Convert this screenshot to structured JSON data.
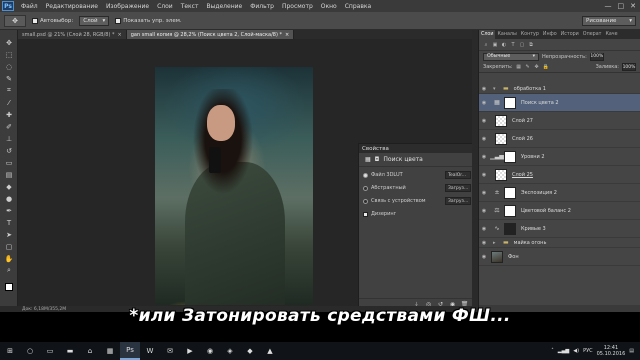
{
  "menubar": {
    "logo": "Ps",
    "items": [
      "Файл",
      "Редактирование",
      "Изображение",
      "Слои",
      "Текст",
      "Выделение",
      "Фильтр",
      "Просмотр",
      "Окно",
      "Справка"
    ],
    "win_controls": [
      "—",
      "□",
      "✕"
    ]
  },
  "options": {
    "autoselect_label": "Автовыбор:",
    "autoselect_value": "Слой",
    "show_controls_label": "Показать упр. элем.",
    "workspace": "Рисование"
  },
  "tabs": [
    {
      "label": "small.psd @ 21% (Слой 28, RGB/8) *",
      "close": "×"
    },
    {
      "label": "gan small копия @ 28,2% (Поиск цвета 2, Слой-маска/8) *",
      "close": "×"
    }
  ],
  "properties": {
    "title": "Свойства",
    "header": "Поиск цвета",
    "rows": [
      {
        "label": "Файл 3DLUT",
        "value": "TealOr...",
        "selected": true
      },
      {
        "label": "Абстрактный",
        "value": "Загруз...",
        "selected": false
      },
      {
        "label": "Связь с устройством",
        "value": "Загруз...",
        "selected": false
      }
    ],
    "dither_label": "Дизеринг"
  },
  "layers_panel": {
    "tabs": [
      "Слои",
      "Каналы",
      "Контур",
      "Инфо",
      "Истори",
      "Операт",
      "Каче"
    ],
    "blend_mode": "Обычные",
    "opacity_label": "Непрозрачность:",
    "opacity_value": "100%",
    "lock_label": "Закрепить:",
    "fill_label": "Заливка:",
    "fill_value": "100%",
    "layers": [
      {
        "name": "обработка 1",
        "kind": "group"
      },
      {
        "name": "Поиск цвета 2",
        "kind": "adjustment",
        "selected": true
      },
      {
        "name": "Слой 27",
        "kind": "pixel"
      },
      {
        "name": "Слой 26",
        "kind": "pixel"
      },
      {
        "name": "Уровни 2",
        "kind": "adjustment"
      },
      {
        "name": "Слой 25",
        "kind": "pixel"
      },
      {
        "name": "Экспозиция 2",
        "kind": "adjustment"
      },
      {
        "name": "Цветовой баланс 2",
        "kind": "adjustment"
      },
      {
        "name": "Кривые 3",
        "kind": "adjustment"
      },
      {
        "name": "майка огонь",
        "kind": "group"
      },
      {
        "name": "Фон",
        "kind": "background"
      }
    ]
  },
  "status": "Док: 6,18M/355,2M",
  "caption": "*или Затонировать средствами ФШ...",
  "taskbar": {
    "lang": "РУС",
    "time": "12:41",
    "date": "05.10.2016"
  }
}
